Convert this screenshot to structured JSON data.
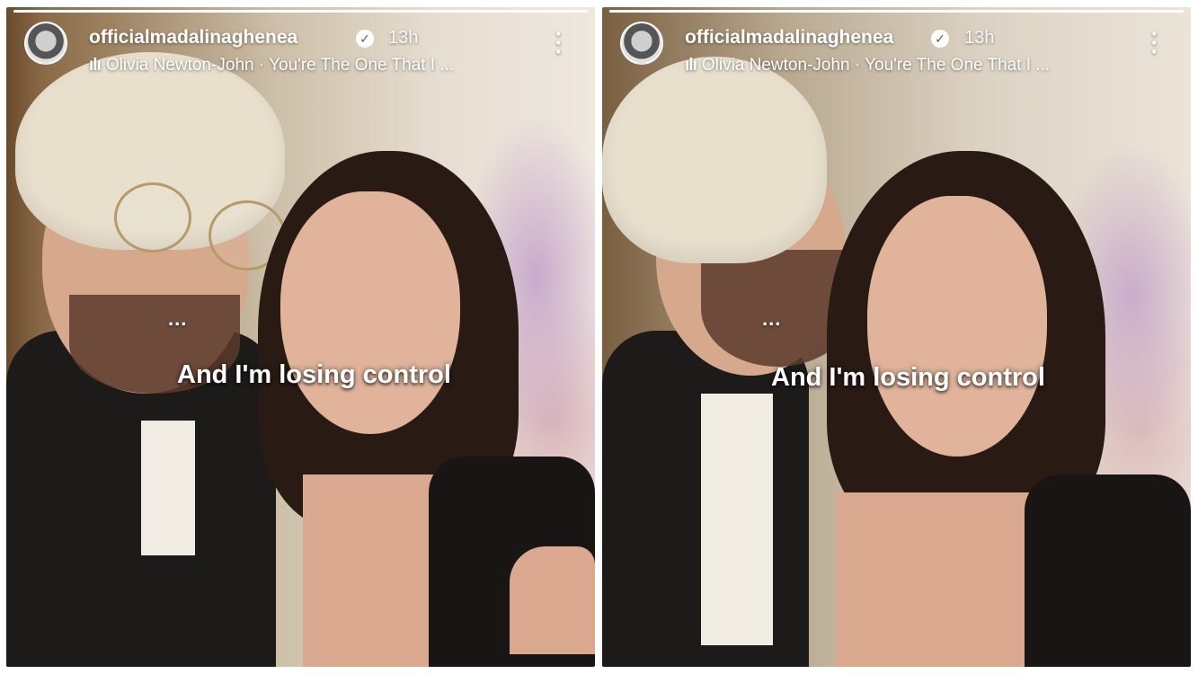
{
  "stories": [
    {
      "username": "officialmadalinaghenea",
      "time_ago": "13h",
      "music": "Olivia Newton-John · You're The One That I ...",
      "caption": "And I'm losing control",
      "typing": "...",
      "progress": 1.0
    },
    {
      "username": "officialmadalinaghenea",
      "time_ago": "13h",
      "music": "Olivia Newton-John · You're The One That I ...",
      "caption": "And I'm losing control",
      "typing": "...",
      "progress": 1.0
    }
  ],
  "icons": {
    "verified": "verified-check-icon",
    "music": "music-bars-icon",
    "more": "vertical-ellipsis-icon"
  }
}
